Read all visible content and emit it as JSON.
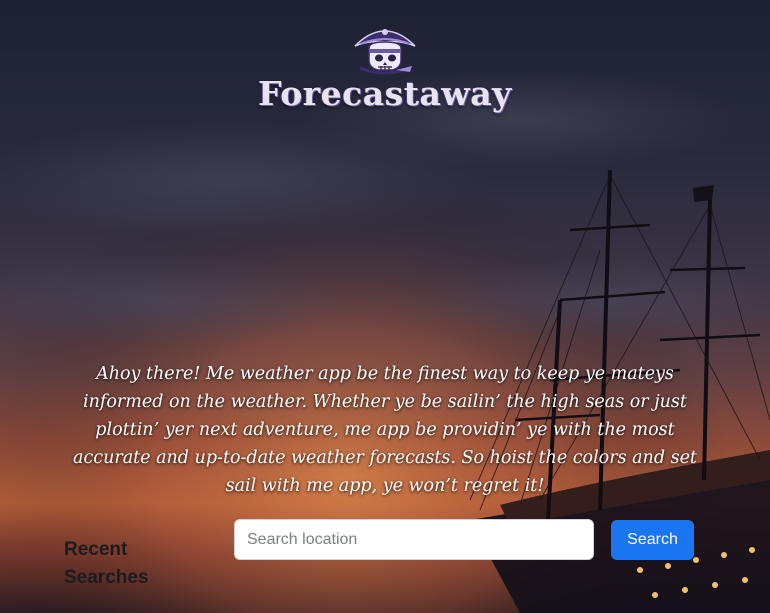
{
  "brand": {
    "name": "Forecastaway",
    "logo_icon": "pirate-skull-icon"
  },
  "intro": {
    "text": "Ahoy there! Me weather app be the finest way to keep ye mateys informed on the weather. Whether ye be sailin’ the high seas or just plottin’ yer next adventure, me app be providin’ ye with the most accurate and up-to-date weather forecasts. So hoist the colors and set sail with me app, ye won’t regret it!"
  },
  "recent": {
    "heading": "Recent Searches"
  },
  "search": {
    "placeholder": "Search location",
    "value": "",
    "button_label": "Search"
  },
  "colors": {
    "button": "#1976f0",
    "logo_purple": "#6b5aa0"
  }
}
